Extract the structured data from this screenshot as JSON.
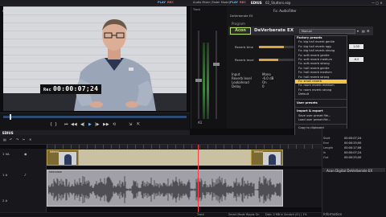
{
  "menubar": {
    "items": [
      "File",
      "Edit",
      "View",
      "Capture",
      "Tools",
      "Render",
      "Settings",
      "Help",
      "Evaluation"
    ],
    "play_label": "PLAY",
    "rec_label": "REC",
    "recorder_label": "Audio Mixer (Fader Mode)",
    "play2_label": "PLAY",
    "rec2_label": "REC",
    "brand": "EDIUS",
    "filename": "02_Stutters.ezp"
  },
  "recorder": {
    "timecode_prefix": "Rec",
    "timecode": "00:00:07;24"
  },
  "mixer": {
    "title": "Track",
    "strip_label": "A1",
    "effect_label": "Fx: AudioFilter"
  },
  "effects": {
    "panel_title": "DeVerberate EX",
    "tab_label": "Program",
    "brand_logo": "Acon",
    "plugin_name": "DeVerberate EX",
    "preset_value": "Manual",
    "params": [
      {
        "label": "Reverb time",
        "value": "1.00"
      },
      {
        "label": "Reverb level",
        "value": "-6.0"
      }
    ],
    "status": [
      {
        "label": "Input",
        "value": "Mono"
      },
      {
        "label": "Reverb level",
        "value": "-6.0 dB"
      },
      {
        "label": "Lookahead",
        "value": "On"
      },
      {
        "label": "Delay",
        "value": "0"
      }
    ]
  },
  "presets_menu": {
    "header": "Factory presets",
    "items": [
      "Fx: big hall reverb gentle",
      "Fx: big hall reverb agg.",
      "Fx: big hall reverb strong",
      "Fx: soft reverb gentle",
      "Fx: soft reverb medium",
      "Fx: soft reverb strong",
      "Fx: hall reverb gentle",
      "Fx: hall reverb medium",
      "Fx: hall reverb strong",
      "Fx: small reverb"
    ],
    "selected_index": 9,
    "more_items": [
      "Fx: room reverb medium",
      "Fx: room reverb strong",
      "Default"
    ],
    "user_header": "User presets",
    "import_header": "Import & export",
    "actions": [
      "Save user preset file...",
      "Load user preset file...",
      "Copy to clipboard"
    ]
  },
  "timeline": {
    "tabs": [
      "Deliver 02",
      "Comments 01",
      "Comp 02",
      "DeVerberate EX"
    ],
    "active_tab": 3,
    "tracks": [
      {
        "name": "1 VA"
      },
      {
        "name": "1 A"
      },
      {
        "name": "2 A"
      }
    ],
    "clip_names": [
      "Intervi",
      "Intervi"
    ],
    "audio_clip_name": "Interview"
  },
  "status_bar": {
    "items": [
      "Track",
      "Smart Mode",
      "Ripple On",
      "Disk: 0 MB in Scratch (E:) | 1%"
    ]
  },
  "properties": {
    "rows": [
      {
        "label": "Start",
        "value": "00:00:07;24"
      },
      {
        "label": "End",
        "value": "00:00:25;00"
      },
      {
        "label": "Length",
        "value": "00:00:17;06"
      },
      {
        "label": "In",
        "value": "00:00:07;24"
      },
      {
        "label": "Out",
        "value": "00:00:25;00"
      }
    ],
    "effect_item": "Acon Digital DeVerberate EX",
    "footer": "Information"
  },
  "colors": {
    "accent_yellow": "#f2c442",
    "acon_green": "#b7e36a",
    "play_blue": "#5db7ff",
    "playhead_red": "#ff4040",
    "clip_gold": "#7b6a31"
  }
}
